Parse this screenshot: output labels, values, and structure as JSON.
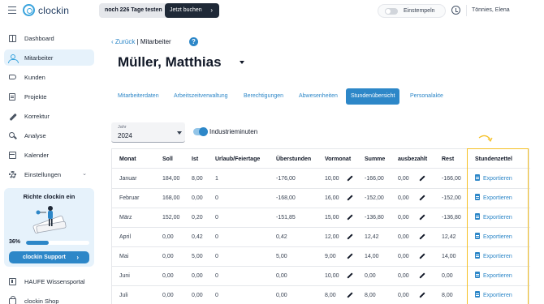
{
  "app": {
    "logo_text": "clockin",
    "trial_text": "noch 226 Tage testen",
    "trial_button": "Jetzt buchen",
    "clock_label": "Einstempeln",
    "user_name": "Tönnies, Elena"
  },
  "sidebar": {
    "items": [
      {
        "label": "Dashboard",
        "icon": "dashboard-icon"
      },
      {
        "label": "Mitarbeiter",
        "icon": "employees-icon",
        "active": true
      },
      {
        "label": "Kunden",
        "icon": "handshake-icon"
      },
      {
        "label": "Projekte",
        "icon": "projects-icon"
      },
      {
        "label": "Korrektur",
        "icon": "pencil-icon"
      },
      {
        "label": "Analyse",
        "icon": "analysis-icon"
      },
      {
        "label": "Kalender",
        "icon": "calendar-icon"
      },
      {
        "label": "Einstellungen",
        "icon": "gear-icon"
      }
    ],
    "bottom_items": [
      {
        "label": "HAUFE Wissensportal",
        "icon": "book-icon"
      },
      {
        "label": "clockin Shop",
        "icon": "shop-icon"
      }
    ],
    "promo": {
      "title": "Richte clockin ein",
      "progress_text": "36%",
      "progress_value": 0.36,
      "button": "clockin Support"
    }
  },
  "main": {
    "breadcrumb": {
      "back": "Zurück",
      "separator": "|",
      "current": "Mitarbeiter"
    },
    "title": "Müller, Matthias",
    "tabs": [
      {
        "label": "Mitarbeiterdaten"
      },
      {
        "label": "Arbeitszeitverwaltung"
      },
      {
        "label": "Berechtigungen"
      },
      {
        "label": "Abwesenheiten"
      },
      {
        "label": "Stundenübersicht",
        "active": true
      },
      {
        "label": "Personalakte"
      }
    ],
    "year": {
      "label": "Jahr",
      "value": "2024"
    },
    "industry_toggle": {
      "label": "Industrieminuten",
      "on": true
    },
    "table": {
      "headers": [
        "Monat",
        "Soll",
        "Ist",
        "Urlaub/Feiertage",
        "Überstunden",
        "Vormonat",
        "Summe",
        "ausbezahlt",
        "Rest",
        "Stundenzettel"
      ],
      "export_label": "Exportieren",
      "rows": [
        [
          "Januar",
          "184,00",
          "8,00",
          "1",
          "-176,00",
          "10,00",
          "-166,00",
          "0,00",
          "-166,00"
        ],
        [
          "Februar",
          "168,00",
          "0,00",
          "0",
          "-168,00",
          "16,00",
          "-152,00",
          "0,00",
          "-152,00"
        ],
        [
          "März",
          "152,00",
          "0,20",
          "0",
          "-151,85",
          "15,00",
          "-136,80",
          "0,00",
          "-136,80"
        ],
        [
          "April",
          "0,00",
          "0,42",
          "0",
          "0,42",
          "12,00",
          "12,42",
          "0,00",
          "12,42"
        ],
        [
          "Mai",
          "0,00",
          "5,00",
          "0",
          "5,00",
          "9,00",
          "14,00",
          "0,00",
          "14,00"
        ],
        [
          "Juni",
          "0,00",
          "0,00",
          "0",
          "0,00",
          "10,00",
          "0,00",
          "0,00",
          "0,00"
        ],
        [
          "Juli",
          "0,00",
          "0,00",
          "0",
          "0,00",
          "8,00",
          "8,00",
          "0,00",
          "8,00"
        ]
      ]
    }
  },
  "colors": {
    "accent": "#2d87c8",
    "highlight": "#f5c024"
  }
}
